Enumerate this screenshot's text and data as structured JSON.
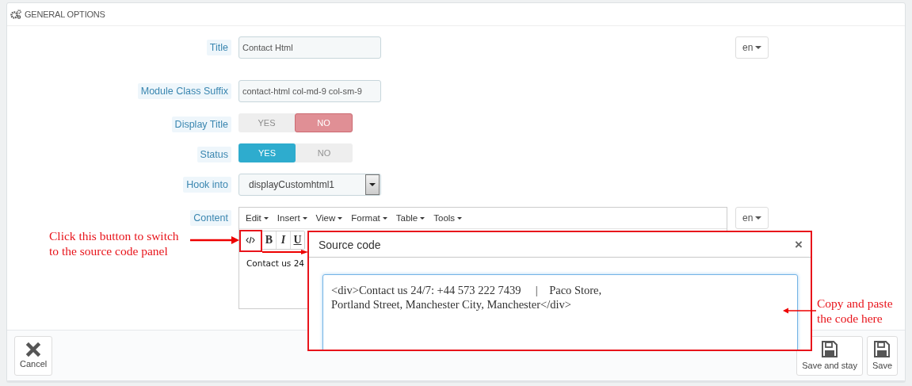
{
  "panel": {
    "title": "GENERAL OPTIONS"
  },
  "fields": [
    {
      "kind": "text",
      "label": "Title",
      "value": "Contact Html",
      "lang": "en"
    },
    {
      "kind": "text",
      "label": "Module Class Suffix",
      "value": "contact-html col-md-9 col-sm-9"
    },
    {
      "kind": "switch",
      "label": "Display Title",
      "options": [
        {
          "kind": "yes",
          "label": "YES",
          "selected": false
        },
        {
          "kind": "no",
          "label": "NO",
          "selected": true
        }
      ]
    },
    {
      "kind": "switch",
      "label": "Status",
      "options": [
        {
          "kind": "yes",
          "label": "YES",
          "selected": true
        },
        {
          "kind": "no",
          "label": "NO",
          "selected": false
        }
      ]
    },
    {
      "kind": "select",
      "label": "Hook into",
      "value": "displayCustomhtml1"
    },
    {
      "kind": "editor",
      "label": "Content",
      "menu": [
        "Edit",
        "Insert",
        "View",
        "Format",
        "Table",
        "Tools"
      ],
      "toolbar": [
        "B",
        "I",
        "U"
      ],
      "content": "Contact us 24",
      "lang": "en"
    }
  ],
  "footer": {
    "buttons": [
      {
        "kind": "cancel",
        "label": "Cancel"
      },
      {
        "kind": "save",
        "label": "Save and stay"
      },
      {
        "kind": "save",
        "label": "Save"
      }
    ]
  },
  "modal": {
    "title": "Source code",
    "close": "×",
    "code": "<div>Contact us 24/7: +44 573 222 7439     |    Paco Store,\nPortland Street, Manchester City, Manchester</div>"
  },
  "annotations": [
    {
      "kind": "left",
      "text": "Click this button to switch to the source code panel"
    },
    {
      "kind": "right",
      "text": "Copy and paste the code here"
    }
  ]
}
